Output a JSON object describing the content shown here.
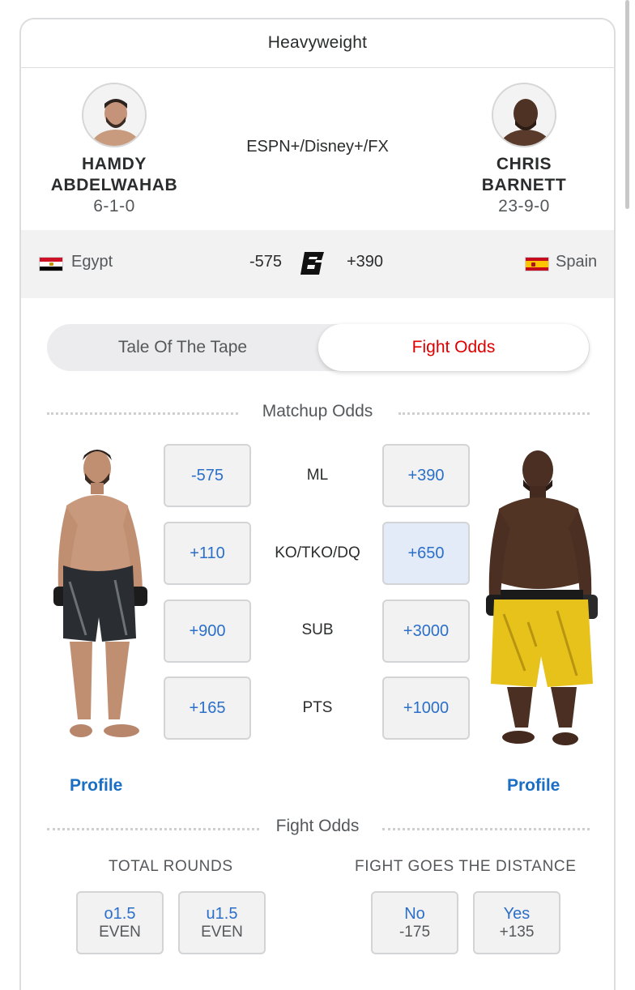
{
  "header": {
    "weight_class": "Heavyweight"
  },
  "fighters": {
    "left": {
      "first": "HAMDY",
      "last": "ABDELWAHAB",
      "record": "6-1-0",
      "country": "Egypt",
      "moneyline": "-575",
      "profile_label": "Profile"
    },
    "right": {
      "first": "CHRIS",
      "last": "BARNETT",
      "record": "23-9-0",
      "country": "Spain",
      "moneyline": "+390",
      "profile_label": "Profile"
    }
  },
  "broadcast": "ESPN+/Disney+/FX",
  "tabs": {
    "tape": "Tale Of The Tape",
    "odds": "Fight Odds",
    "active": "odds"
  },
  "matchup": {
    "title": "Matchup Odds",
    "rows": [
      {
        "label": "ML",
        "left": "-575",
        "right": "+390"
      },
      {
        "label": "KO/TKO/DQ",
        "left": "+110",
        "right": "+650",
        "selected": "right"
      },
      {
        "label": "SUB",
        "left": "+900",
        "right": "+3000"
      },
      {
        "label": "PTS",
        "left": "+165",
        "right": "+1000"
      }
    ]
  },
  "fight_odds": {
    "title": "Fight Odds",
    "total_rounds": {
      "label": "TOTAL ROUNDS",
      "options": [
        {
          "line": "o1.5",
          "price": "EVEN"
        },
        {
          "line": "u1.5",
          "price": "EVEN"
        }
      ]
    },
    "distance": {
      "label": "FIGHT GOES THE DISTANCE",
      "options": [
        {
          "line": "No",
          "price": "-175"
        },
        {
          "line": "Yes",
          "price": "+135"
        }
      ]
    }
  },
  "colors": {
    "accent_red": "#dd0000",
    "link_blue": "#1a6ec4",
    "odds_blue": "#2b6fc9",
    "selected_bg": "#e3eaf8"
  },
  "icons": {
    "betting_logo": "espn-bet-icon",
    "egypt_flag": "egypt-flag-icon",
    "spain_flag": "spain-flag-icon"
  }
}
